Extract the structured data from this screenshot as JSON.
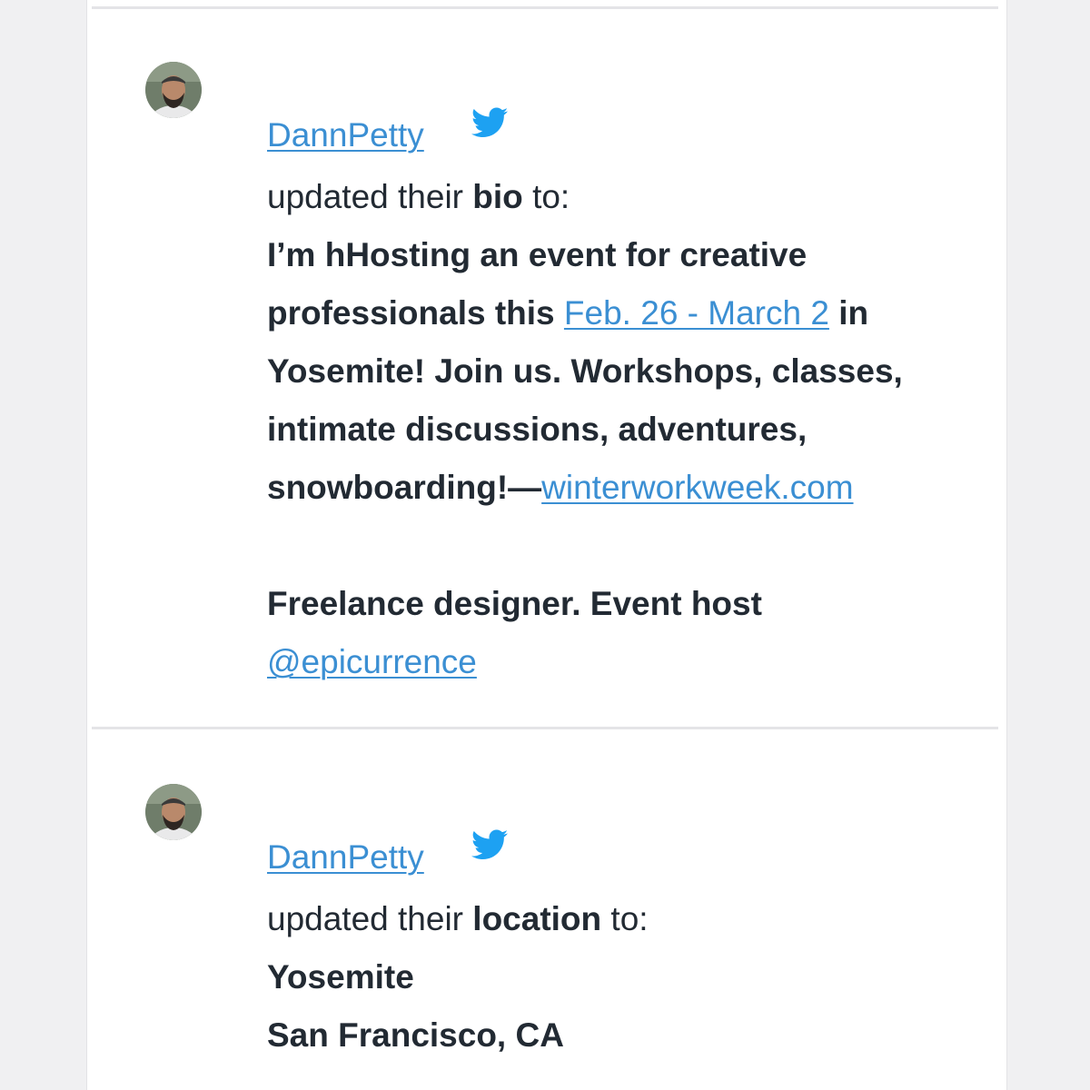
{
  "feed": {
    "entries": [
      {
        "username": "DannPetty",
        "action_prefix": "updated their",
        "field": "bio",
        "action_suffix": "to:",
        "bio_lines": [
          "I’m hHosting an event for creative",
          "professionals this",
          "in",
          "Yosemite! Join us. Workshops, classes,",
          "intimate discussions, adventures,",
          "snowboarding!—",
          "Freelance designer. Event host"
        ],
        "date_link": "Feb. 26 - March 2",
        "site_link": "winterworkweek.com",
        "mention_link": "@epicurrence"
      },
      {
        "username": "DannPetty",
        "action_prefix": "updated their",
        "field": "location",
        "action_suffix": "to:",
        "location_lines": [
          "Yosemite",
          "San Francisco, CA"
        ]
      }
    ]
  },
  "colors": {
    "link": "#3b8fd3",
    "text": "#222a33",
    "twitter_blue": "#1da1f2",
    "background": "#f0f0f2"
  },
  "icons": {
    "platform": "twitter-bird-icon",
    "avatar": "user-avatar"
  }
}
